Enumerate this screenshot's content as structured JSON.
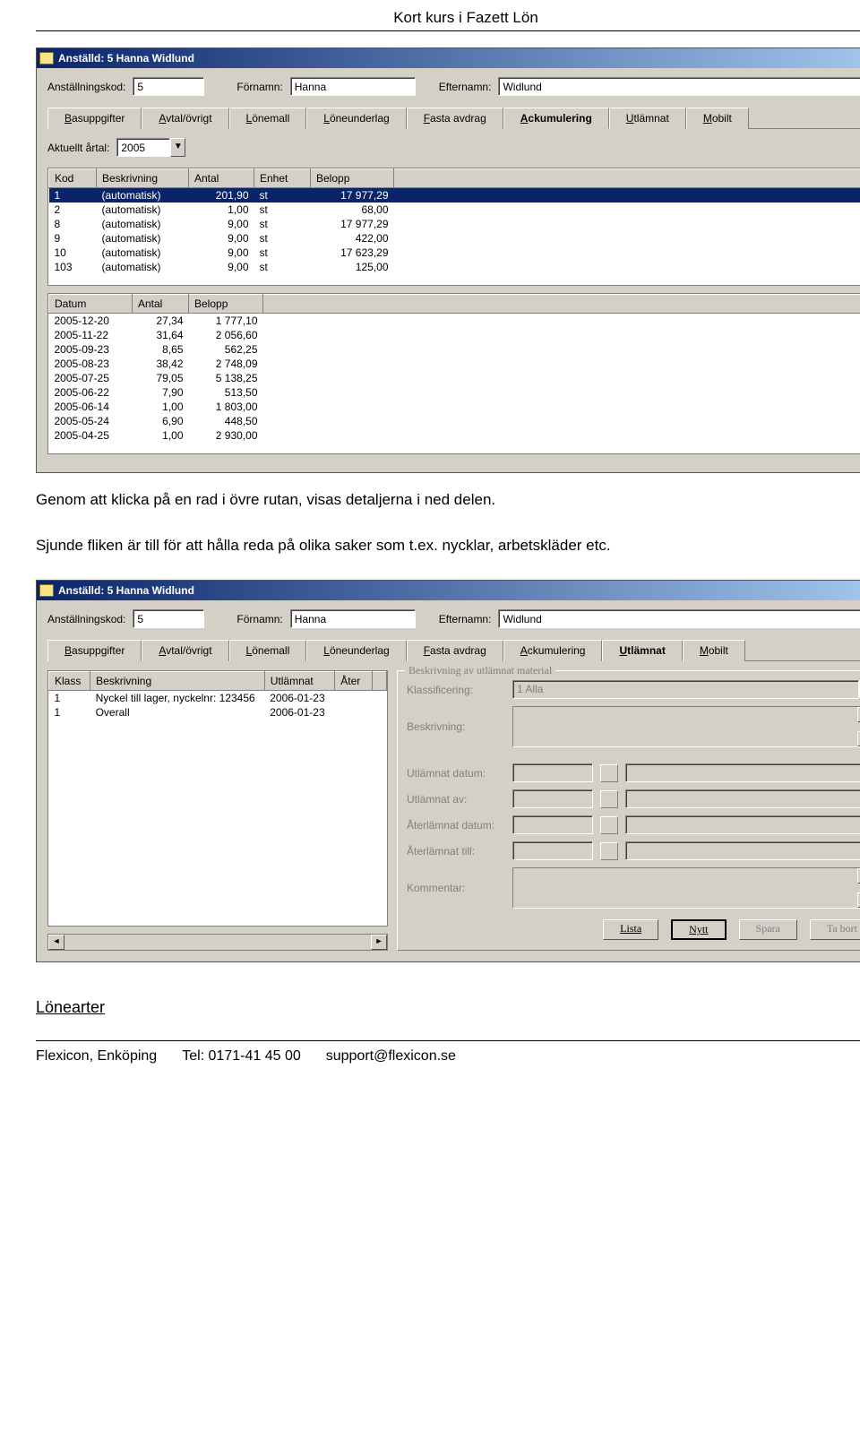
{
  "page": {
    "header": "Kort kurs i Fazett Lön",
    "para1": "Genom att klicka på en rad i övre rutan, visas detaljerna i ned delen.",
    "para2": "Sjunde fliken är till för att hålla reda på olika saker som t.ex. nycklar, arbetskläder etc.",
    "heading": "Lönearter",
    "footer_company": "Flexicon, Enköping",
    "footer_tel": "Tel: 0171-41 45 00",
    "footer_email": "support@flexicon.se"
  },
  "win1": {
    "title": "Anställd: 5 Hanna Widlund",
    "fields": {
      "kod_label": "Anställningskod:",
      "kod": "5",
      "fornamn_label": "Förnamn:",
      "fornamn": "Hanna",
      "efternamn_label": "Efternamn:",
      "efternamn": "Widlund",
      "artal_label": "Aktuellt årtal:",
      "artal": "2005"
    },
    "tabs": [
      "Basuppgifter",
      "Avtal/övrigt",
      "Lönemall",
      "Löneunderlag",
      "Fasta avdrag",
      "Ackumulering",
      "Utlämnat",
      "Mobilt"
    ],
    "active_tab": 5,
    "grid1": {
      "headers": [
        "Kod",
        "Beskrivning",
        "Antal",
        "Enhet",
        "Belopp"
      ],
      "rows": [
        [
          "1",
          "(automatisk)",
          "201,90",
          "st",
          "17 977,29"
        ],
        [
          "2",
          "(automatisk)",
          "1,00",
          "st",
          "68,00"
        ],
        [
          "8",
          "(automatisk)",
          "9,00",
          "st",
          "17 977,29"
        ],
        [
          "9",
          "(automatisk)",
          "9,00",
          "st",
          "422,00"
        ],
        [
          "10",
          "(automatisk)",
          "9,00",
          "st",
          "17 623,29"
        ],
        [
          "103",
          "(automatisk)",
          "9,00",
          "st",
          "125,00"
        ]
      ],
      "selected": 0
    },
    "grid2": {
      "headers": [
        "Datum",
        "Antal",
        "Belopp"
      ],
      "rows": [
        [
          "2005-12-20",
          "27,34",
          "1 777,10"
        ],
        [
          "2005-11-22",
          "31,64",
          "2 056,60"
        ],
        [
          "2005-09-23",
          "8,65",
          "562,25"
        ],
        [
          "2005-08-23",
          "38,42",
          "2 748,09"
        ],
        [
          "2005-07-25",
          "79,05",
          "5 138,25"
        ],
        [
          "2005-06-22",
          "7,90",
          "513,50"
        ],
        [
          "2005-06-14",
          "1,00",
          "1 803,00"
        ],
        [
          "2005-05-24",
          "6,90",
          "448,50"
        ],
        [
          "2005-04-25",
          "1,00",
          "2 930,00"
        ]
      ]
    }
  },
  "win2": {
    "title": "Anställd: 5 Hanna Widlund",
    "fields": {
      "kod_label": "Anställningskod:",
      "kod": "5",
      "fornamn_label": "Förnamn:",
      "fornamn": "Hanna",
      "efternamn_label": "Efternamn:",
      "efternamn": "Widlund"
    },
    "tabs": [
      "Basuppgifter",
      "Avtal/övrigt",
      "Lönemall",
      "Löneunderlag",
      "Fasta avdrag",
      "Ackumulering",
      "Utlämnat",
      "Mobilt"
    ],
    "active_tab": 6,
    "grid": {
      "headers": [
        "Klass",
        "Beskrivning",
        "Utlämnat",
        "Åter"
      ],
      "rows": [
        [
          "1",
          "Nyckel till lager, nyckelnr: 123456",
          "2006-01-23",
          ""
        ],
        [
          "1",
          "Overall",
          "2006-01-23",
          ""
        ]
      ]
    },
    "detail": {
      "group_title": "Beskrivning av utlämnat material",
      "klass_label": "Klassificering:",
      "klass_value": "1  Alla",
      "beskr_label": "Beskrivning:",
      "utdatum_label": "Utlämnat datum:",
      "utav_label": "Utlämnat av:",
      "aterdatum_label": "Återlämnat datum:",
      "atertill_label": "Återlämnat till:",
      "kommentar_label": "Kommentar:"
    },
    "buttons": {
      "lista": "Lista",
      "nytt": "Nytt",
      "spara": "Spara",
      "tabort": "Ta bort"
    }
  }
}
